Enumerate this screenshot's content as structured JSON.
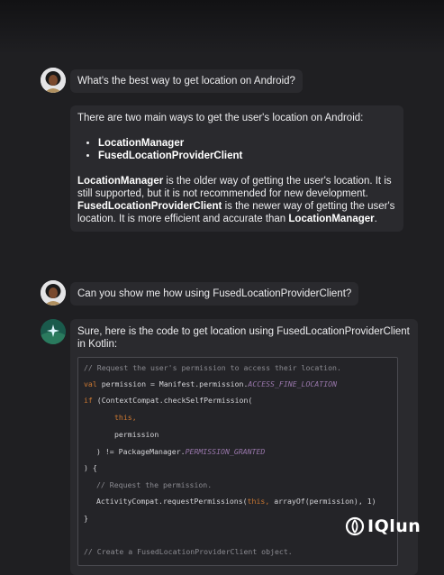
{
  "conversation": {
    "q1": "What's the best way to get location on Android?",
    "a1": {
      "intro": "There are two main ways to get the user's location on Android:",
      "bullets": [
        "LocationManager",
        "FusedLocationProviderClient"
      ],
      "p1_bold": "LocationManager",
      "p1_rest": " is the older way of getting the user's location. It is still supported, but it is not recommended for new development.",
      "p2_bold": "FusedLocationProviderClient",
      "p2_rest": " is the newer way of getting the user's location. It is more efficient and accurate than ",
      "p2_bold2": "LocationManager",
      "p2_end": "."
    },
    "q2": "Can you show me how using FusedLocationProviderClient?",
    "a2": {
      "intro": "Sure, here is the code to get location using FusedLocationProviderClient in Kotlin:"
    }
  },
  "code": {
    "l1": "// Request the user's permission to access their location.",
    "l2a": "val",
    "l2b": " permission = Manifest.permission.",
    "l2c": "ACCESS_FINE_LOCATION",
    "l3a": "if",
    "l3b": " (ContextCompat.checkSelfPermission(",
    "l4": "this,",
    "l5": "permission",
    "l6a": ") != PackageManager.",
    "l6b": "PERMISSION_GRANTED",
    "l7": ") {",
    "l8": "// Request the permission.",
    "l9a": "ActivityCompat.requestPermissions(",
    "l9b": "this,",
    "l9c": " arrayOf(permission), 1)",
    "l10": "}",
    "l11": "// Create a FusedLocationProviderClient object."
  },
  "watermark": {
    "text": "IQlun"
  },
  "colors": {
    "background": "#1f1f22",
    "bubble": "#2a2a2e",
    "code_keyword": "#cc7832",
    "code_constant": "#9876aa",
    "code_comment": "#8a8a90",
    "bot_icon": "#1a5a4c"
  },
  "icons": {
    "user_avatar": "user-avatar",
    "bot_avatar": "sparkle-icon",
    "watermark_logo": "iqlun-logo-icon"
  }
}
